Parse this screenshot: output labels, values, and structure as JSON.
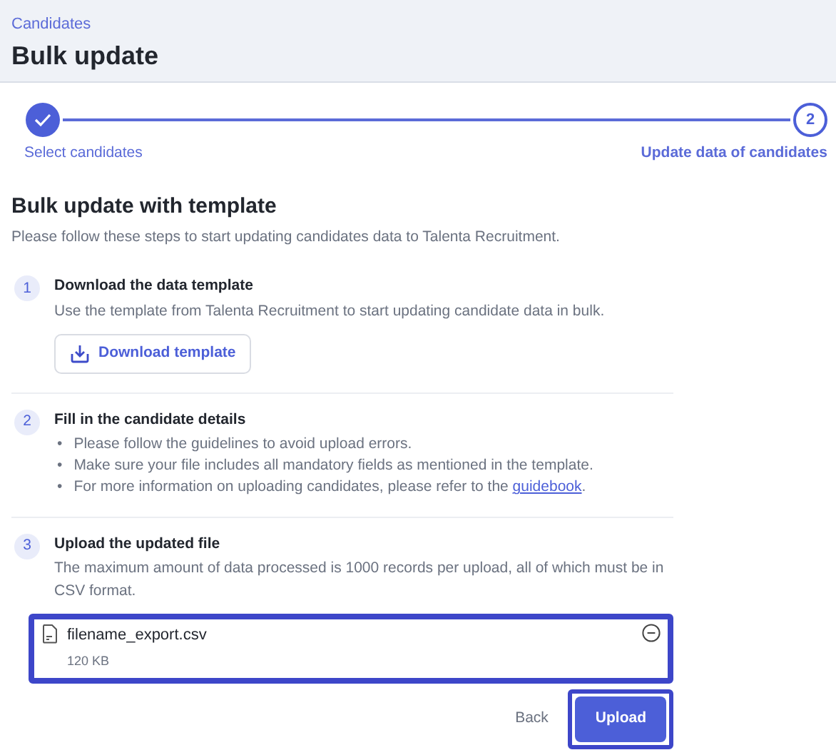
{
  "header": {
    "breadcrumb": "Candidates",
    "title": "Bulk update"
  },
  "stepper": [
    {
      "label": "Select candidates",
      "done": true
    },
    {
      "number": "2",
      "label": "Update data of candidates",
      "done": false
    }
  ],
  "section": {
    "title": "Bulk update with template",
    "subtitle": "Please follow these steps to start updating candidates data to Talenta Recruitment."
  },
  "steps": [
    {
      "number": "1",
      "title": "Download the data template",
      "kind": "download",
      "text": "Use the template from Talenta Recruitment to start updating candidate data in bulk.",
      "button": "Download template"
    },
    {
      "number": "2",
      "title": "Fill in the candidate details",
      "kind": "bullets",
      "marker": "•",
      "bullets": [
        "Please follow the guidelines to avoid upload errors.",
        "Make sure your file includes all mandatory fields as mentioned in the template.",
        "For more information on uploading candidates, please refer to the "
      ],
      "link": "guidebook",
      "after_link": "."
    },
    {
      "number": "3",
      "title": "Upload the updated file",
      "kind": "upload",
      "text": "The maximum amount of data processed is 1000 records per upload, all of which must be in CSV format.",
      "file": {
        "name": "filename_export.csv",
        "size": "120 KB",
        "highlighted": true
      }
    }
  ],
  "actions": {
    "back": "Back",
    "upload": "Upload",
    "upload_highlighted": true
  }
}
